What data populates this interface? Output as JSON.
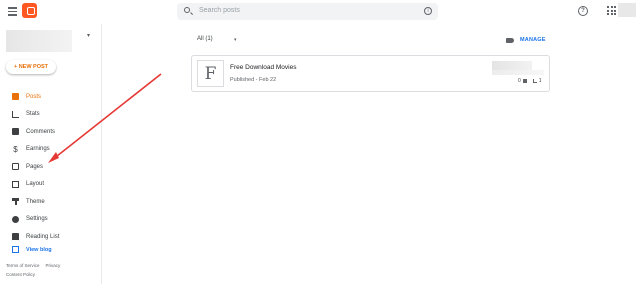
{
  "header": {
    "search_placeholder": "Search posts",
    "help_symbol": "?",
    "info_symbol": "i"
  },
  "sidebar": {
    "new_post_label": "+ NEW POST",
    "blog_chevron": "▾",
    "items": [
      {
        "label": "Posts",
        "icon": "posts-icon"
      },
      {
        "label": "Stats",
        "icon": "stats-icon"
      },
      {
        "label": "Comments",
        "icon": "comments-icon"
      },
      {
        "label": "Earnings",
        "icon": "earnings-icon",
        "glyph": "$"
      },
      {
        "label": "Pages",
        "icon": "pages-icon"
      },
      {
        "label": "Layout",
        "icon": "layout-icon"
      },
      {
        "label": "Theme",
        "icon": "theme-icon"
      },
      {
        "label": "Settings",
        "icon": "settings-icon"
      },
      {
        "label": "Reading List",
        "icon": "reading-list-icon"
      }
    ],
    "view_blog_label": "View blog",
    "footer": {
      "terms": "Terms of Service",
      "privacy": "Privacy",
      "content_policy": "Content Policy"
    }
  },
  "main": {
    "filter_label": "All (1)",
    "filter_chevron": "▾",
    "manage_label": "MANAGE",
    "posts": [
      {
        "thumb_letter": "F",
        "title": "Free Download Movies",
        "status": "Published - Feb 22",
        "comments": "0",
        "views": "1"
      }
    ]
  },
  "colors": {
    "accent": "#e8710a",
    "logo": "#ff5722",
    "link": "#1a73e8",
    "annotation_arrow": "#e53935"
  }
}
